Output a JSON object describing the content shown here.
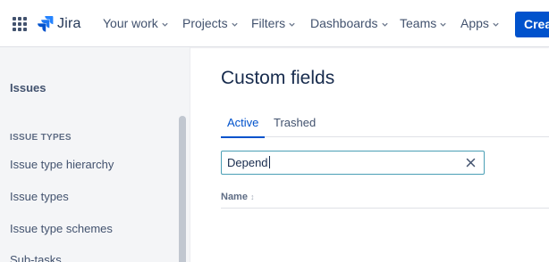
{
  "nav": {
    "logo_text": "Jira",
    "items": [
      {
        "label": "Your work"
      },
      {
        "label": "Projects"
      },
      {
        "label": "Filters"
      },
      {
        "label": "Dashboards"
      },
      {
        "label": "Teams"
      },
      {
        "label": "Apps"
      }
    ],
    "create_label": "Crea"
  },
  "sidebar": {
    "title": "Issues",
    "section_label": "ISSUE TYPES",
    "items": [
      {
        "label": "Issue type hierarchy"
      },
      {
        "label": "Issue types"
      },
      {
        "label": "Issue type schemes"
      },
      {
        "label": "Sub-tasks"
      }
    ]
  },
  "main": {
    "title": "Custom fields",
    "tabs": [
      {
        "label": "Active",
        "active": true
      },
      {
        "label": "Trashed",
        "active": false
      }
    ],
    "search": {
      "value": "Depend"
    },
    "columns": [
      {
        "label": "Name"
      }
    ]
  },
  "colors": {
    "accent": "#0052cc",
    "search_border": "#4a9fb5",
    "sidebar_bg": "#f4f5f7"
  }
}
